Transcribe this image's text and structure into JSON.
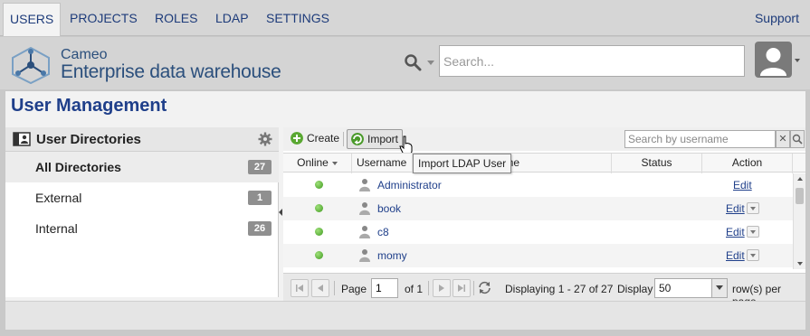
{
  "nav": {
    "tabs": [
      {
        "label": "USERS",
        "active": true
      },
      {
        "label": "PROJECTS",
        "active": false
      },
      {
        "label": "ROLES",
        "active": false
      },
      {
        "label": "LDAP",
        "active": false
      },
      {
        "label": "SETTINGS",
        "active": false
      }
    ],
    "support": "Support"
  },
  "header": {
    "brand_line1": "Cameo",
    "brand_line2": "Enterprise data warehouse",
    "search_placeholder": "Search...",
    "search_icon": "magnifier-icon",
    "avatar_icon": "user-silhouette-icon"
  },
  "page": {
    "title": "User Management"
  },
  "directories": {
    "heading": "User Directories",
    "items": [
      {
        "label": "All Directories",
        "count": "27",
        "selected": true
      },
      {
        "label": "External",
        "count": "1",
        "selected": false
      },
      {
        "label": "Internal",
        "count": "26",
        "selected": false
      }
    ]
  },
  "toolbar": {
    "create_label": "Create",
    "import_label": "Import",
    "search_placeholder": "Search by username",
    "clear_label": "✕"
  },
  "tooltip": "Import LDAP User",
  "table": {
    "columns": [
      "Online",
      "Username",
      "l Name",
      "Status",
      "Action"
    ],
    "rows": [
      {
        "username": "Administrator",
        "action": "Edit",
        "has_menu": false
      },
      {
        "username": "book",
        "action": "Edit",
        "has_menu": true
      },
      {
        "username": "c8",
        "action": "Edit",
        "has_menu": true
      },
      {
        "username": "momy",
        "action": "Edit",
        "has_menu": true
      }
    ]
  },
  "pager": {
    "page_label": "Page",
    "page_value": "1",
    "of_label": "of 1",
    "displaying": "Displaying 1 - 27 of 27",
    "display_label": "Display",
    "display_value": "50",
    "per_page_label": "row(s) per page"
  },
  "colors": {
    "accent": "#1f3f8a",
    "online": "#3f9a1f",
    "badge": "#8f8f8f"
  }
}
